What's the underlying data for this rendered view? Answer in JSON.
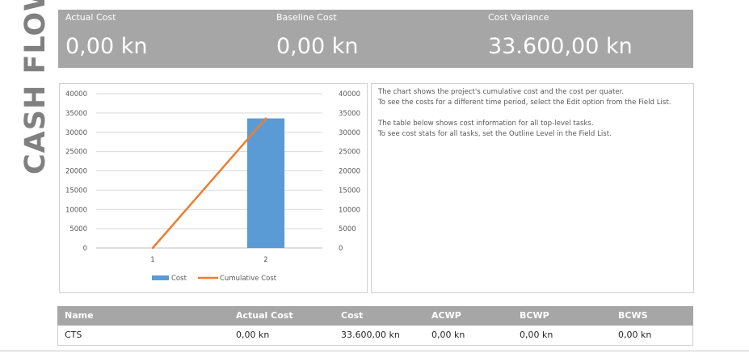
{
  "side_title": "CASH FLOW",
  "kpis": [
    {
      "label": "Actual Cost",
      "value": "0,00 kn"
    },
    {
      "label": "Baseline Cost",
      "value": "0,00 kn"
    },
    {
      "label": "Cost Variance",
      "value": "33.600,00 kn"
    }
  ],
  "notes": [
    "The chart shows the project's cumulative cost and the cost per quater.",
    "To see the costs for a different time period, select the Edit option from the Field List.",
    "The table below shows cost information for all top-level tasks.",
    "To see cost stats for all tasks, set the Outline Level in the Field List."
  ],
  "table": {
    "headers": [
      "Name",
      "Actual Cost",
      "Cost",
      "ACWP",
      "BCWP",
      "BCWS"
    ],
    "rows": [
      [
        "CTS",
        "0,00 kn",
        "33.600,00 kn",
        "0,00 kn",
        "0,00 kn",
        "0,00 kn"
      ]
    ]
  },
  "colors": {
    "header_gray": "#a6a6a6",
    "title_gray": "#808080",
    "bar_blue": "#5b9bd5",
    "line_orange": "#ed7d31"
  },
  "chart_data": {
    "type": "bar",
    "categories": [
      "1",
      "2"
    ],
    "series": [
      {
        "name": "Cost",
        "type": "bar",
        "axis": "left",
        "values": [
          0,
          33600
        ]
      },
      {
        "name": "Cumulative Cost",
        "type": "line",
        "axis": "right",
        "values": [
          0,
          33600
        ]
      }
    ],
    "y_ticks": [
      0,
      5000,
      10000,
      15000,
      20000,
      25000,
      30000,
      35000,
      40000
    ],
    "ylim": [
      0,
      40000
    ],
    "y2lim": [
      0,
      40000
    ],
    "legend_position": "bottom",
    "grid": true
  }
}
